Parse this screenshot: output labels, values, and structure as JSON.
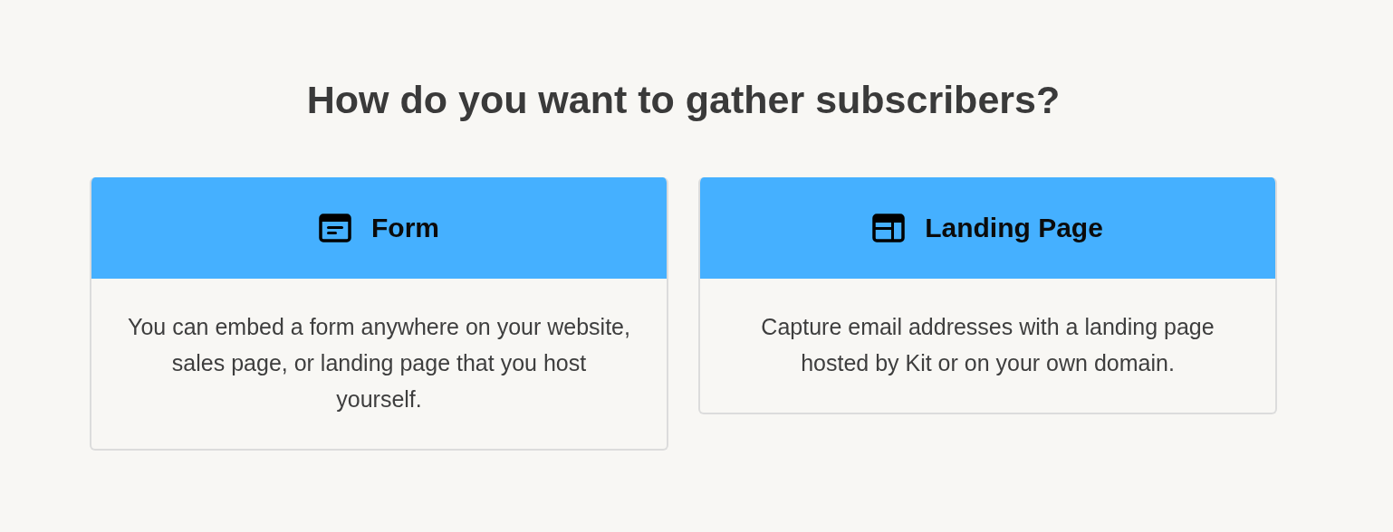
{
  "heading": "How do you want to gather subscribers?",
  "options": [
    {
      "kind": "form",
      "title": "Form",
      "description": "You can embed a form anywhere on your website, sales page, or landing page that you host yourself."
    },
    {
      "kind": "landing_page",
      "title": "Landing Page",
      "description": "Capture email addresses with a landing page hosted by Kit or on your own domain."
    }
  ]
}
